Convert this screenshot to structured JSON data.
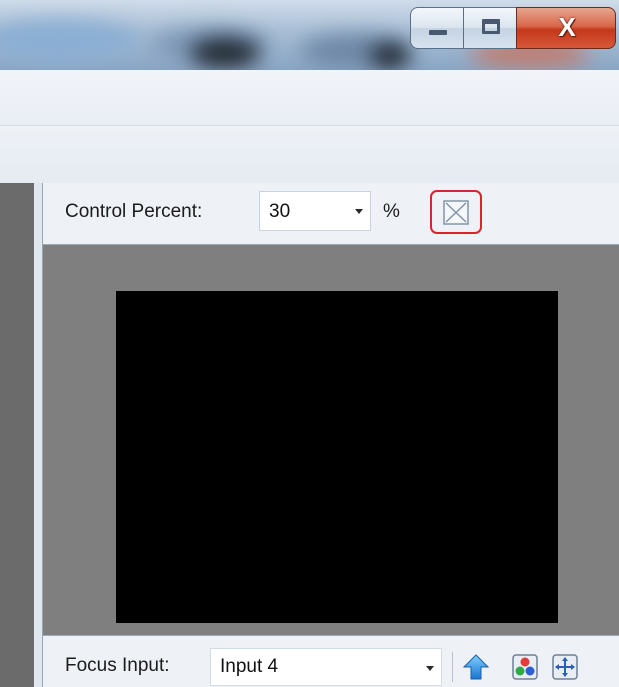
{
  "titlebar": {
    "close_glyph": "X"
  },
  "panel": {
    "control_percent_label": "Control Percent:",
    "control_percent_value": "30",
    "percent_unit": "%",
    "focus_input_label": "Focus Input:",
    "focus_input_value": "Input 4"
  },
  "colors": {
    "highlight_border": "#d9242d",
    "video_background": "#000000",
    "panel_gray": "#7f7f7f"
  },
  "icons": {
    "fit": "fit-to-window-icon",
    "up": "blue-up-arrow-icon",
    "color": "color-dots-icon",
    "move": "move-arrows-icon"
  }
}
